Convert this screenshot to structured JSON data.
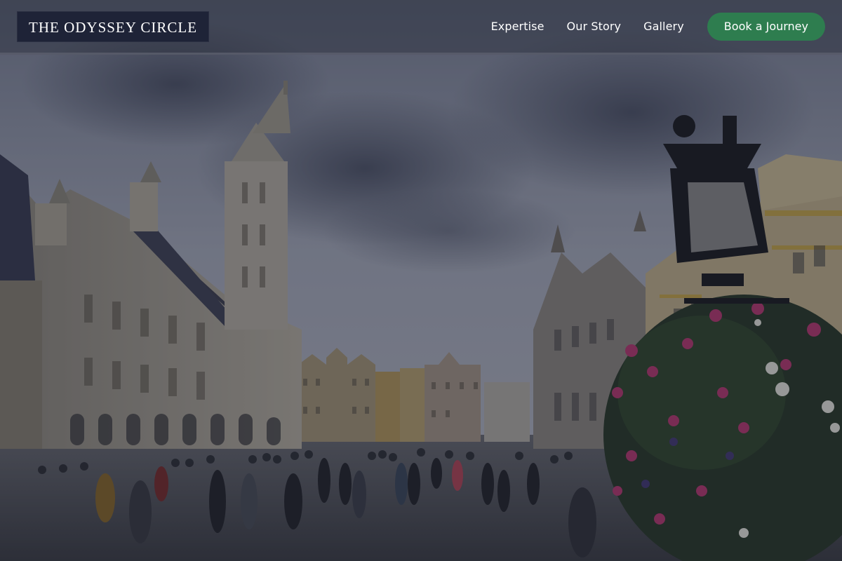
{
  "brand": {
    "logo_text": "THE ODYSSEY CIRCLE"
  },
  "nav": {
    "links": [
      {
        "label": "Expertise"
      },
      {
        "label": "Our Story"
      },
      {
        "label": "Gallery"
      }
    ],
    "cta_label": "Book a Journey"
  },
  "hero": {
    "image_subject": "Grand Place square with gothic town hall, guild houses, crowd, street lamp and flowers"
  },
  "colors": {
    "logo_bg": "#1e2337",
    "cta_bg": "#2e7d4f",
    "text": "#ffffff"
  }
}
